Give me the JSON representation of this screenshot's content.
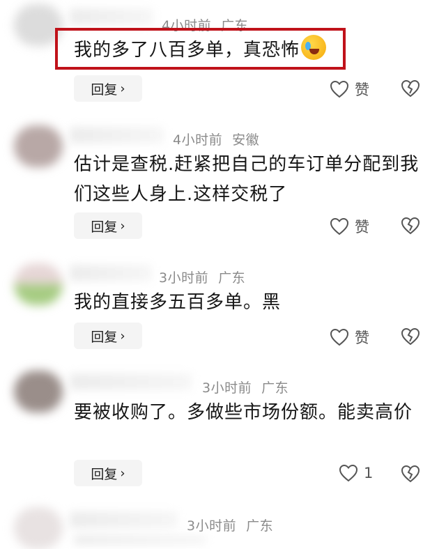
{
  "comments": [
    {
      "time": "4小时前",
      "location": "广东",
      "text": "我的多了八百多单，真恐怖",
      "emoji": "loudly-crying-laughing-emoji",
      "reply_label": "回复",
      "like_label": "赞"
    },
    {
      "time": "4小时前",
      "location": "安徽",
      "text": "估计是查税.赶紧把自己的车订单分配到我们这些人身上.这样交税了",
      "reply_label": "回复",
      "like_label": "赞"
    },
    {
      "time": "3小时前",
      "location": "广东",
      "text": "我的直接多五百多单。黑",
      "reply_label": "回复",
      "like_label": "赞"
    },
    {
      "time": "3小时前",
      "location": "广东",
      "text": "要被收购了。多做些市场份额。能卖高价",
      "reply_label": "回复",
      "like_label": "1"
    },
    {
      "time": "3小时前",
      "location": "广东"
    }
  ],
  "colors": {
    "highlight_border": "#c0121a",
    "meta_text": "#8a8a8a",
    "reply_bg": "#f4f4f4"
  },
  "icons": {
    "like": "heart-outline-icon",
    "dislike": "broken-heart-outline-icon",
    "reply_chevron": "chevron-right-icon"
  }
}
